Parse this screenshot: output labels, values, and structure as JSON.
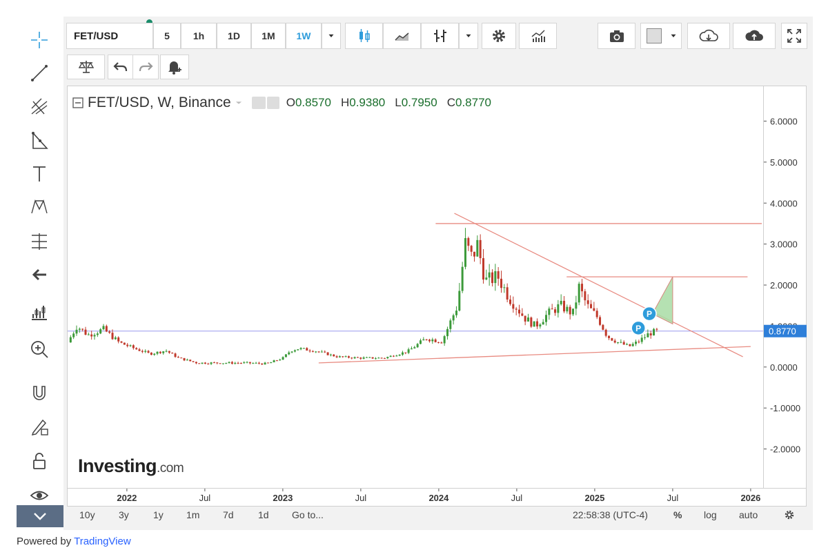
{
  "toolbar": {
    "symbol": "FET/USD",
    "intervals": [
      "5",
      "1h",
      "1D",
      "1M",
      "1W"
    ],
    "active_interval": "1W",
    "accent": "#2e9cdb"
  },
  "left_tools": [
    "crosshair-icon",
    "trendline-icon",
    "pitchfork-icon",
    "triangle-pattern-icon",
    "text-icon",
    "xabcd-pattern-icon",
    "measure-icon",
    "arrow-left-icon",
    "long-position-icon",
    "zoom-in-icon",
    "magnet-icon",
    "lock-drawing-icon",
    "unlock-icon",
    "eye-icon",
    "collapse-chevron-icon"
  ],
  "legend": {
    "title": "FET/USD, W, Binance",
    "o_label": "O",
    "o_value": "0.8570",
    "h_label": "H",
    "h_value": "0.9380",
    "l_label": "L",
    "l_value": "0.7950",
    "c_label": "C",
    "c_value": "0.8770"
  },
  "bottom": {
    "ranges": [
      "10y",
      "3y",
      "1y",
      "1m",
      "7d",
      "1d"
    ],
    "goto": "Go to...",
    "clock": "22:58:38 (UTC-4)",
    "percent": "%",
    "log": "log",
    "auto": "auto"
  },
  "logo": {
    "main": "Investing",
    "suffix": ".com"
  },
  "powered": {
    "prefix": "Powered by ",
    "link": "TradingView"
  },
  "chart_data": {
    "type": "candlestick",
    "title": "FET/USD, W, Binance",
    "last_price": 0.877,
    "last_price_label": "0.8770",
    "y_ticks": [
      6,
      5,
      4,
      3,
      2,
      1,
      0,
      -1,
      -2
    ],
    "y_tick_labels": [
      "6.0000",
      "5.0000",
      "4.0000",
      "3.0000",
      "2.0000",
      "1.0000",
      "0.0000",
      "-1.0000",
      "-2.0000"
    ],
    "x_ticks": [
      {
        "label": "2022",
        "t": 2022.0
      },
      {
        "label": "Jul",
        "t": 2022.5
      },
      {
        "label": "2023",
        "t": 2023.0
      },
      {
        "label": "Jul",
        "t": 2023.5
      },
      {
        "label": "2024",
        "t": 2024.0
      },
      {
        "label": "Jul",
        "t": 2024.5
      },
      {
        "label": "2025",
        "t": 2025.0
      },
      {
        "label": "Jul",
        "t": 2025.5
      },
      {
        "label": "2026",
        "t": 2026.0
      }
    ],
    "x_range": [
      2021.62,
      2026.08
    ],
    "y_range": [
      -2.95,
      6.85
    ],
    "series": [
      {
        "t": 2021.62,
        "v": 0.6
      },
      {
        "t": 2021.68,
        "v": 1.0
      },
      {
        "t": 2021.75,
        "v": 0.78
      },
      {
        "t": 2021.85,
        "v": 0.92
      },
      {
        "t": 2021.95,
        "v": 0.6
      },
      {
        "t": 2022.05,
        "v": 0.45
      },
      {
        "t": 2022.15,
        "v": 0.32
      },
      {
        "t": 2022.25,
        "v": 0.4
      },
      {
        "t": 2022.33,
        "v": 0.22
      },
      {
        "t": 2022.45,
        "v": 0.1
      },
      {
        "t": 2022.6,
        "v": 0.1
      },
      {
        "t": 2022.75,
        "v": 0.1
      },
      {
        "t": 2022.9,
        "v": 0.08
      },
      {
        "t": 2023.0,
        "v": 0.22
      },
      {
        "t": 2023.05,
        "v": 0.4
      },
      {
        "t": 2023.1,
        "v": 0.45
      },
      {
        "t": 2023.2,
        "v": 0.4
      },
      {
        "t": 2023.35,
        "v": 0.25
      },
      {
        "t": 2023.5,
        "v": 0.22
      },
      {
        "t": 2023.65,
        "v": 0.22
      },
      {
        "t": 2023.8,
        "v": 0.38
      },
      {
        "t": 2023.92,
        "v": 0.7
      },
      {
        "t": 2024.02,
        "v": 0.62
      },
      {
        "t": 2024.12,
        "v": 1.5
      },
      {
        "t": 2024.17,
        "v": 3.0
      },
      {
        "t": 2024.22,
        "v": 2.6
      },
      {
        "t": 2024.24,
        "v": 3.1
      },
      {
        "t": 2024.3,
        "v": 2.1
      },
      {
        "t": 2024.38,
        "v": 2.2
      },
      {
        "t": 2024.45,
        "v": 1.7
      },
      {
        "t": 2024.55,
        "v": 1.2
      },
      {
        "t": 2024.62,
        "v": 1.0
      },
      {
        "t": 2024.7,
        "v": 1.3
      },
      {
        "t": 2024.78,
        "v": 1.5
      },
      {
        "t": 2024.86,
        "v": 1.3
      },
      {
        "t": 2024.9,
        "v": 1.95
      },
      {
        "t": 2024.95,
        "v": 1.5
      },
      {
        "t": 2025.02,
        "v": 1.2
      },
      {
        "t": 2025.08,
        "v": 0.75
      },
      {
        "t": 2025.15,
        "v": 0.6
      },
      {
        "t": 2025.22,
        "v": 0.5
      },
      {
        "t": 2025.28,
        "v": 0.62
      },
      {
        "t": 2025.35,
        "v": 0.82
      },
      {
        "t": 2025.4,
        "v": 0.877
      }
    ],
    "annotations": {
      "resistance_top": 3.5,
      "resistance_mid": 2.2,
      "descending_trendline": [
        {
          "t": 2024.1,
          "v": 3.75
        },
        {
          "t": 2025.95,
          "v": 0.25
        }
      ],
      "ascending_trendline": [
        {
          "t": 2023.23,
          "v": 0.1
        },
        {
          "t": 2026.0,
          "v": 0.5
        }
      ],
      "target_triangle": [
        {
          "t": 2025.5,
          "v": 1.05
        },
        {
          "t": 2025.5,
          "v": 2.2
        },
        {
          "t": 2025.37,
          "v": 1.3
        }
      ],
      "markers": [
        {
          "t": 2025.28,
          "v": 0.95,
          "label": "P"
        },
        {
          "t": 2025.35,
          "v": 1.3,
          "label": "P"
        }
      ]
    }
  }
}
